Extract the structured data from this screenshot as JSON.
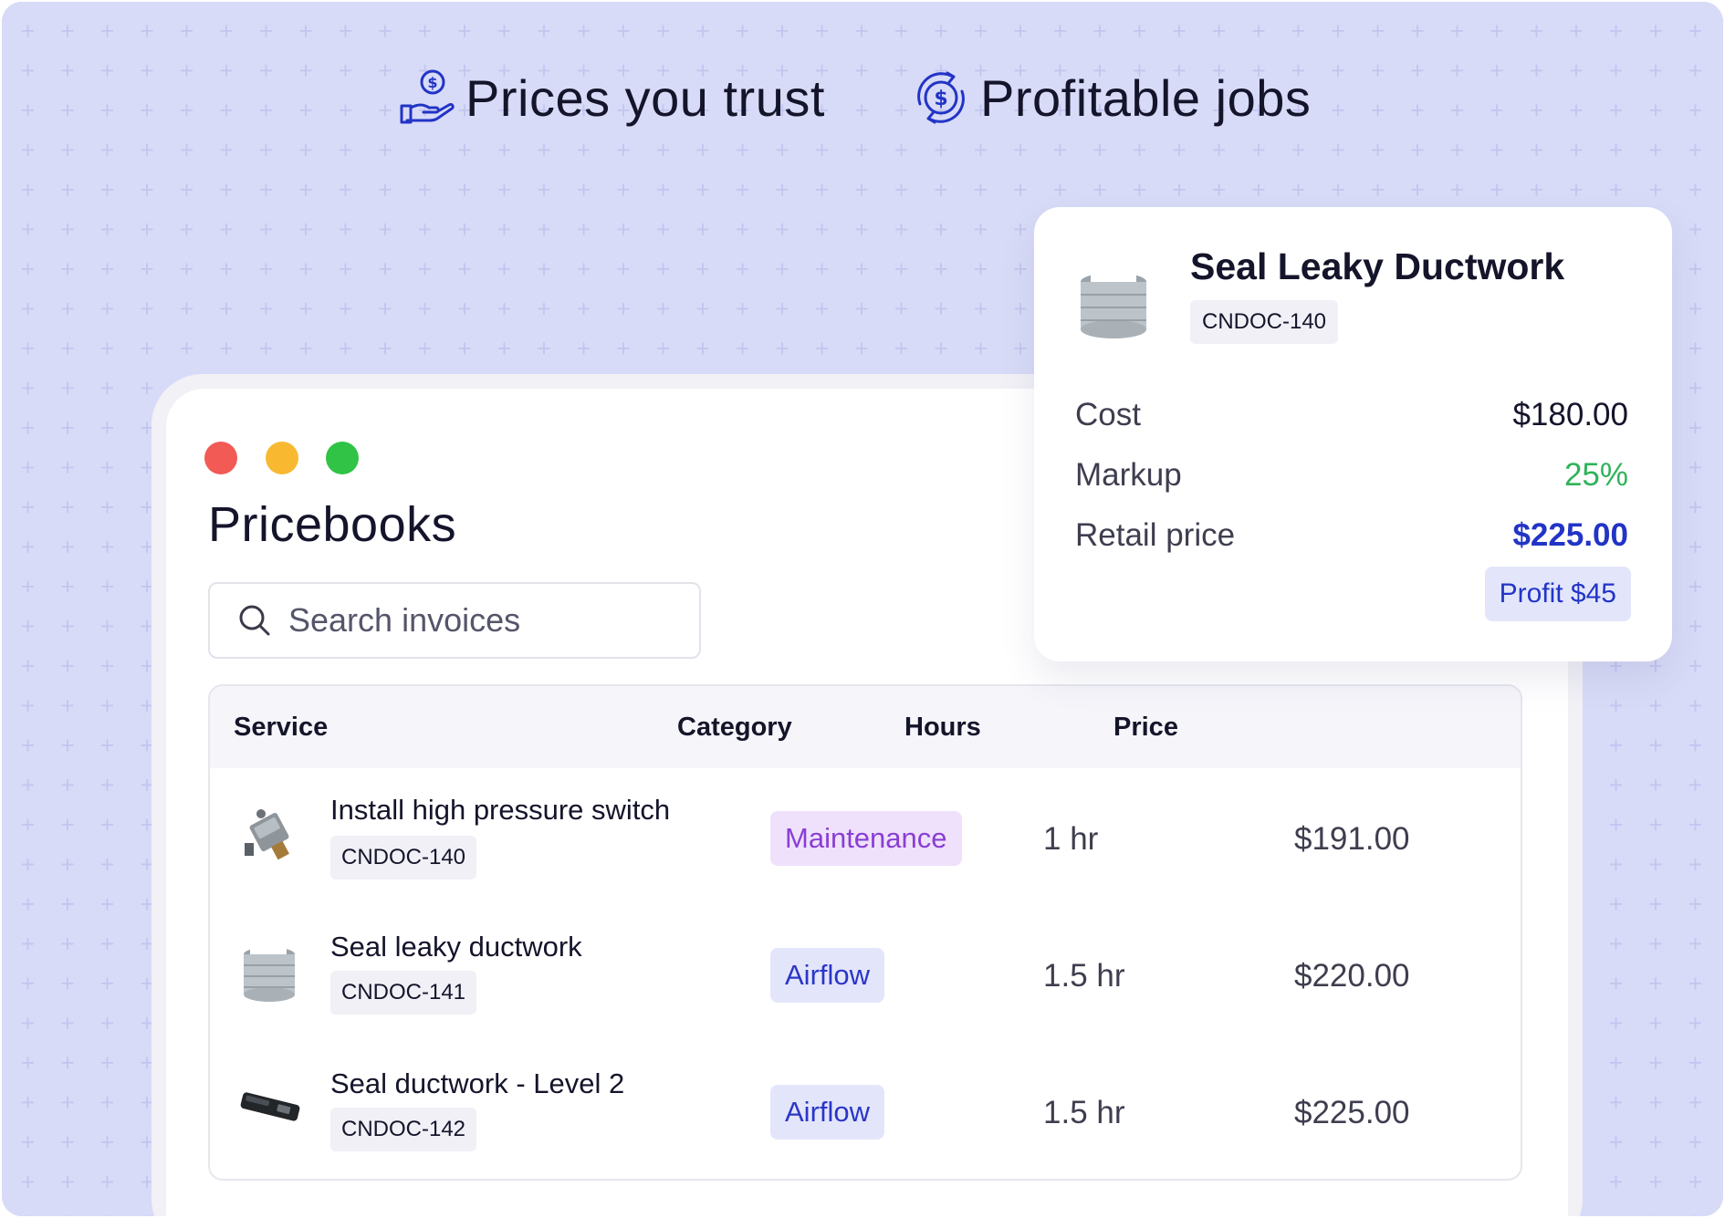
{
  "hero": {
    "item1": {
      "label": "Prices you trust",
      "icon": "hand-coin-icon"
    },
    "item2": {
      "label": "Profitable jobs",
      "icon": "dollar-cycle-icon"
    }
  },
  "colors": {
    "background": "#d8dbf7",
    "accent_blue": "#2234c6",
    "green": "#2fb35a",
    "purple": "#8a3ed4"
  },
  "pricebooks": {
    "title": "Pricebooks",
    "search": {
      "placeholder": "Search invoices",
      "value": ""
    },
    "columns": [
      "Service",
      "Category",
      "Hours",
      "Price"
    ],
    "rows": [
      {
        "name": "Install high pressure switch",
        "code": "CNDOC-140",
        "category": "Maintenance",
        "hours": "1 hr",
        "price": "$191.00",
        "icon": "pressure-switch-image"
      },
      {
        "name": "Seal leaky ductwork",
        "code": "CNDOC-141",
        "category": "Airflow",
        "hours": "1.5 hr",
        "price": "$220.00",
        "icon": "duct-image"
      },
      {
        "name": "Seal ductwork - Level 2",
        "code": "CNDOC-142",
        "category": "Airflow",
        "hours": "1.5 hr",
        "price": "$225.00",
        "icon": "sealing-tool-image"
      }
    ]
  },
  "detail_card": {
    "title": "Seal Leaky Ductwork",
    "code": "CNDOC-140",
    "cost_label": "Cost",
    "cost_value": "$180.00",
    "markup_label": "Markup",
    "markup_value": "25%",
    "retail_label": "Retail price",
    "retail_value": "$225.00",
    "profit": "Profit $45"
  }
}
